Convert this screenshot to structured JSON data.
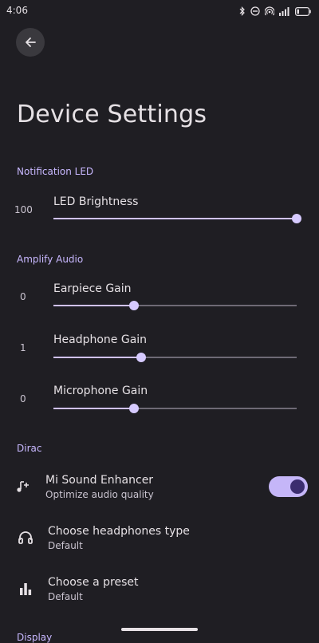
{
  "status_bar": {
    "time": "4:06",
    "icons": [
      "bluetooth-icon",
      "do-not-disturb-icon",
      "hotspot-icon",
      "signal-icon",
      "battery-icon"
    ]
  },
  "header": {
    "back_icon": "arrow-back-icon",
    "title": "Device Settings"
  },
  "sections": {
    "notification_led": {
      "header": "Notification LED",
      "sliders": [
        {
          "label": "LED Brightness",
          "value": "100",
          "fraction": 1.0
        }
      ]
    },
    "amplify_audio": {
      "header": "Amplify Audio",
      "sliders": [
        {
          "label": "Earpiece Gain",
          "value": "0",
          "fraction": 0.33
        },
        {
          "label": "Headphone Gain",
          "value": "1",
          "fraction": 0.36
        },
        {
          "label": "Microphone Gain",
          "value": "0",
          "fraction": 0.33
        }
      ]
    },
    "dirac": {
      "header": "Dirac",
      "items": [
        {
          "title": "Mi Sound Enhancer",
          "summary": "Optimize audio quality",
          "icon": "music-note-add-icon",
          "toggle_on": true
        },
        {
          "title": "Choose headphones type",
          "summary": "Default",
          "icon": "headphones-icon"
        },
        {
          "title": "Choose a preset",
          "summary": "Default",
          "icon": "equalizer-icon"
        }
      ]
    },
    "display": {
      "header": "Display"
    }
  },
  "colors": {
    "background": "#1f1e23",
    "accent": "#c8b8ff",
    "slider_active": "#d0c2ff",
    "slider_inactive": "#6e6a75",
    "switch_track": "#c5b6f8",
    "switch_knob": "#3b2d6f"
  }
}
